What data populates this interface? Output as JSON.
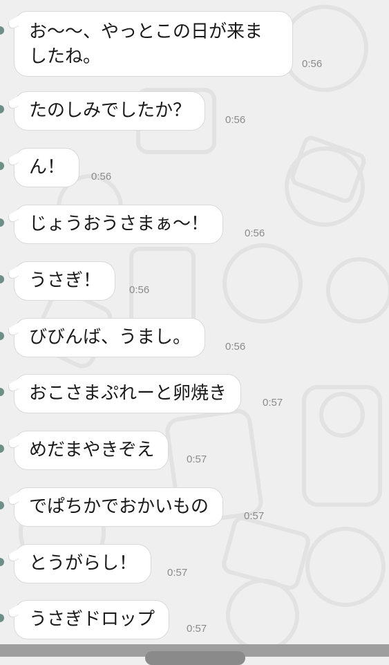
{
  "messages": [
    {
      "text": "お〜〜、やっとこの日が来ましたね。",
      "time": "0:56"
    },
    {
      "text": "たのしみでしたか？",
      "time": "0:56"
    },
    {
      "text": "ん！",
      "time": "0:56"
    },
    {
      "text": "じょうおうさまぁ〜！",
      "time": "0:56"
    },
    {
      "text": "うさぎ！",
      "time": "0:56"
    },
    {
      "text": "びびんば、うまし。",
      "time": "0:56"
    },
    {
      "text": "おこさまぷれーと卵焼き",
      "time": "0:57"
    },
    {
      "text": "めだまやきぞえ",
      "time": "0:57"
    },
    {
      "text": "でぱちかでおかいもの",
      "time": "0:57"
    },
    {
      "text": "とうがらし！",
      "time": "0:57"
    },
    {
      "text": "うさぎドロップ",
      "time": "0:57"
    }
  ],
  "colors": {
    "background": "#efefef",
    "bubble": "#ffffff",
    "bubble_border": "#d9d9d9",
    "text": "#1a1a1a",
    "time": "#8a8a8a",
    "avatar_edge": "#6f8f86"
  }
}
